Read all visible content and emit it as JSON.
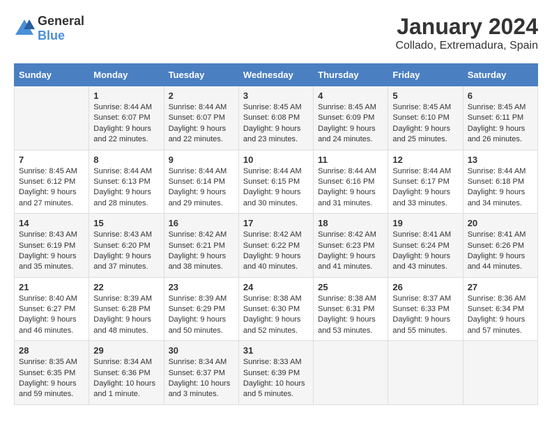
{
  "header": {
    "logo_general": "General",
    "logo_blue": "Blue",
    "month_year": "January 2024",
    "location": "Collado, Extremadura, Spain"
  },
  "columns": [
    "Sunday",
    "Monday",
    "Tuesday",
    "Wednesday",
    "Thursday",
    "Friday",
    "Saturday"
  ],
  "weeks": [
    [
      {
        "day": "",
        "sunrise": "",
        "sunset": "",
        "daylight": ""
      },
      {
        "day": "1",
        "sunrise": "Sunrise: 8:44 AM",
        "sunset": "Sunset: 6:07 PM",
        "daylight": "Daylight: 9 hours and 22 minutes."
      },
      {
        "day": "2",
        "sunrise": "Sunrise: 8:44 AM",
        "sunset": "Sunset: 6:07 PM",
        "daylight": "Daylight: 9 hours and 22 minutes."
      },
      {
        "day": "3",
        "sunrise": "Sunrise: 8:45 AM",
        "sunset": "Sunset: 6:08 PM",
        "daylight": "Daylight: 9 hours and 23 minutes."
      },
      {
        "day": "4",
        "sunrise": "Sunrise: 8:45 AM",
        "sunset": "Sunset: 6:09 PM",
        "daylight": "Daylight: 9 hours and 24 minutes."
      },
      {
        "day": "5",
        "sunrise": "Sunrise: 8:45 AM",
        "sunset": "Sunset: 6:10 PM",
        "daylight": "Daylight: 9 hours and 25 minutes."
      },
      {
        "day": "6",
        "sunrise": "Sunrise: 8:45 AM",
        "sunset": "Sunset: 6:11 PM",
        "daylight": "Daylight: 9 hours and 26 minutes."
      }
    ],
    [
      {
        "day": "7",
        "sunrise": "Sunrise: 8:45 AM",
        "sunset": "Sunset: 6:12 PM",
        "daylight": "Daylight: 9 hours and 27 minutes."
      },
      {
        "day": "8",
        "sunrise": "Sunrise: 8:44 AM",
        "sunset": "Sunset: 6:13 PM",
        "daylight": "Daylight: 9 hours and 28 minutes."
      },
      {
        "day": "9",
        "sunrise": "Sunrise: 8:44 AM",
        "sunset": "Sunset: 6:14 PM",
        "daylight": "Daylight: 9 hours and 29 minutes."
      },
      {
        "day": "10",
        "sunrise": "Sunrise: 8:44 AM",
        "sunset": "Sunset: 6:15 PM",
        "daylight": "Daylight: 9 hours and 30 minutes."
      },
      {
        "day": "11",
        "sunrise": "Sunrise: 8:44 AM",
        "sunset": "Sunset: 6:16 PM",
        "daylight": "Daylight: 9 hours and 31 minutes."
      },
      {
        "day": "12",
        "sunrise": "Sunrise: 8:44 AM",
        "sunset": "Sunset: 6:17 PM",
        "daylight": "Daylight: 9 hours and 33 minutes."
      },
      {
        "day": "13",
        "sunrise": "Sunrise: 8:44 AM",
        "sunset": "Sunset: 6:18 PM",
        "daylight": "Daylight: 9 hours and 34 minutes."
      }
    ],
    [
      {
        "day": "14",
        "sunrise": "Sunrise: 8:43 AM",
        "sunset": "Sunset: 6:19 PM",
        "daylight": "Daylight: 9 hours and 35 minutes."
      },
      {
        "day": "15",
        "sunrise": "Sunrise: 8:43 AM",
        "sunset": "Sunset: 6:20 PM",
        "daylight": "Daylight: 9 hours and 37 minutes."
      },
      {
        "day": "16",
        "sunrise": "Sunrise: 8:42 AM",
        "sunset": "Sunset: 6:21 PM",
        "daylight": "Daylight: 9 hours and 38 minutes."
      },
      {
        "day": "17",
        "sunrise": "Sunrise: 8:42 AM",
        "sunset": "Sunset: 6:22 PM",
        "daylight": "Daylight: 9 hours and 40 minutes."
      },
      {
        "day": "18",
        "sunrise": "Sunrise: 8:42 AM",
        "sunset": "Sunset: 6:23 PM",
        "daylight": "Daylight: 9 hours and 41 minutes."
      },
      {
        "day": "19",
        "sunrise": "Sunrise: 8:41 AM",
        "sunset": "Sunset: 6:24 PM",
        "daylight": "Daylight: 9 hours and 43 minutes."
      },
      {
        "day": "20",
        "sunrise": "Sunrise: 8:41 AM",
        "sunset": "Sunset: 6:26 PM",
        "daylight": "Daylight: 9 hours and 44 minutes."
      }
    ],
    [
      {
        "day": "21",
        "sunrise": "Sunrise: 8:40 AM",
        "sunset": "Sunset: 6:27 PM",
        "daylight": "Daylight: 9 hours and 46 minutes."
      },
      {
        "day": "22",
        "sunrise": "Sunrise: 8:39 AM",
        "sunset": "Sunset: 6:28 PM",
        "daylight": "Daylight: 9 hours and 48 minutes."
      },
      {
        "day": "23",
        "sunrise": "Sunrise: 8:39 AM",
        "sunset": "Sunset: 6:29 PM",
        "daylight": "Daylight: 9 hours and 50 minutes."
      },
      {
        "day": "24",
        "sunrise": "Sunrise: 8:38 AM",
        "sunset": "Sunset: 6:30 PM",
        "daylight": "Daylight: 9 hours and 52 minutes."
      },
      {
        "day": "25",
        "sunrise": "Sunrise: 8:38 AM",
        "sunset": "Sunset: 6:31 PM",
        "daylight": "Daylight: 9 hours and 53 minutes."
      },
      {
        "day": "26",
        "sunrise": "Sunrise: 8:37 AM",
        "sunset": "Sunset: 6:33 PM",
        "daylight": "Daylight: 9 hours and 55 minutes."
      },
      {
        "day": "27",
        "sunrise": "Sunrise: 8:36 AM",
        "sunset": "Sunset: 6:34 PM",
        "daylight": "Daylight: 9 hours and 57 minutes."
      }
    ],
    [
      {
        "day": "28",
        "sunrise": "Sunrise: 8:35 AM",
        "sunset": "Sunset: 6:35 PM",
        "daylight": "Daylight: 9 hours and 59 minutes."
      },
      {
        "day": "29",
        "sunrise": "Sunrise: 8:34 AM",
        "sunset": "Sunset: 6:36 PM",
        "daylight": "Daylight: 10 hours and 1 minute."
      },
      {
        "day": "30",
        "sunrise": "Sunrise: 8:34 AM",
        "sunset": "Sunset: 6:37 PM",
        "daylight": "Daylight: 10 hours and 3 minutes."
      },
      {
        "day": "31",
        "sunrise": "Sunrise: 8:33 AM",
        "sunset": "Sunset: 6:39 PM",
        "daylight": "Daylight: 10 hours and 5 minutes."
      },
      {
        "day": "",
        "sunrise": "",
        "sunset": "",
        "daylight": ""
      },
      {
        "day": "",
        "sunrise": "",
        "sunset": "",
        "daylight": ""
      },
      {
        "day": "",
        "sunrise": "",
        "sunset": "",
        "daylight": ""
      }
    ]
  ]
}
